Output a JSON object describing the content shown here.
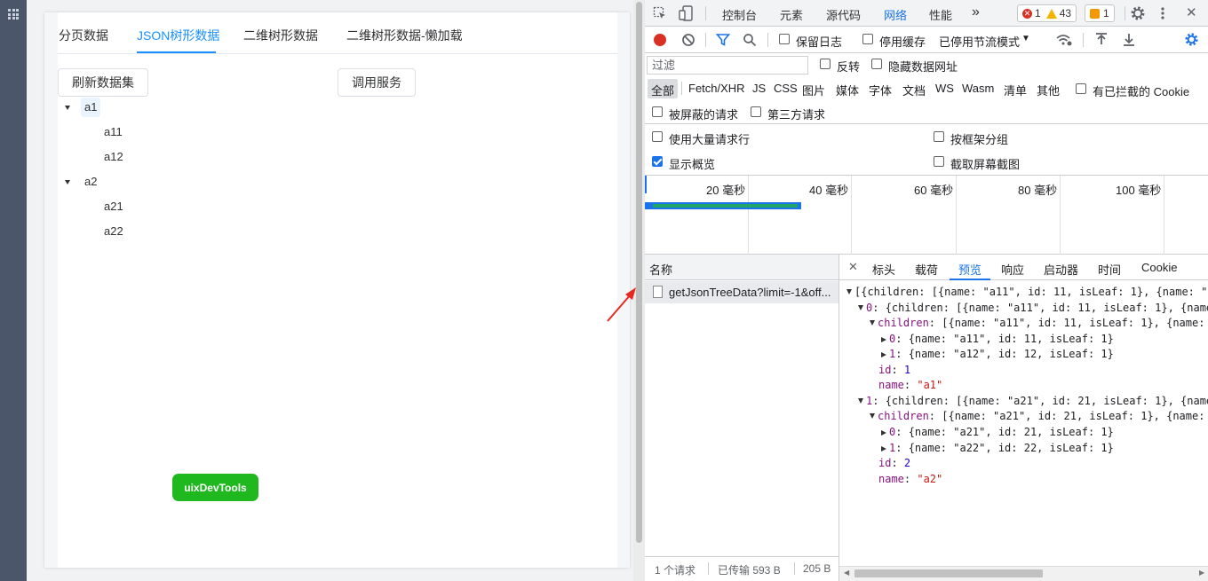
{
  "app": {
    "tabs": [
      {
        "label": "分页数据"
      },
      {
        "label": "JSON树形数据"
      },
      {
        "label": "二维树形数据"
      },
      {
        "label": "二维树形数据-懒加载"
      }
    ],
    "active_tab": 1,
    "refresh_button": "刷新数据集",
    "call_service_button": "调用服务",
    "tree": [
      {
        "label": "a1",
        "children": [
          "a11",
          "a12"
        ]
      },
      {
        "label": "a2",
        "children": [
          "a21",
          "a22"
        ]
      }
    ],
    "devtools_button": "uixDevTools"
  },
  "devtools": {
    "tabs": [
      "控制台",
      "元素",
      "源代码",
      "网络",
      "性能"
    ],
    "active_tab": "网络",
    "more": "»",
    "errors": "1",
    "warnings": "43",
    "messages": "1",
    "close": "✕",
    "toolbar": {
      "preserve_log": "保留日志",
      "disable_cache": "停用缓存",
      "throttle": "已停用节流模式",
      "throttle_arrow": "▼"
    },
    "filter": {
      "placeholder": "过滤",
      "invert": "反转",
      "hide_data_urls": "隐藏数据网址"
    },
    "types": [
      "全部",
      "Fetch/XHR",
      "JS",
      "CSS",
      "图片",
      "媒体",
      "字体",
      "文档",
      "WS",
      "Wasm",
      "清单",
      "其他"
    ],
    "blocked_cookies": "有已拦截的 Cookie",
    "blocked_requests": "被屏蔽的请求",
    "third_party": "第三方请求",
    "settings": {
      "large_rows": "使用大量请求行",
      "group_by_frame": "按框架分组",
      "show_overview": "显示概览",
      "capture_screenshots": "截取屏幕截图"
    },
    "timeline_ticks": [
      "20 毫秒",
      "40 毫秒",
      "60 毫秒",
      "80 毫秒",
      "100 毫秒"
    ],
    "request_list": {
      "header": "名称",
      "rows": [
        "getJsonTreeData?limit=-1&off..."
      ]
    },
    "status_bar": {
      "requests": "1 个请求",
      "transferred": "已传输 593 B",
      "resources": "205 B"
    },
    "detail_tabs": [
      "标头",
      "载荷",
      "预览",
      "响应",
      "启动器",
      "时间",
      "Cookie"
    ],
    "detail_active": "预览",
    "preview_lines": [
      {
        "indent": 0,
        "toggle": "open",
        "text": "[{children: [{name: \"a11\", id: 11, isLeaf: 1}, {name: \"a1"
      },
      {
        "indent": 1,
        "toggle": "open",
        "key": "0",
        "text": "{children: [{name: \"a11\", id: 11, isLeaf: 1}, {name:"
      },
      {
        "indent": 2,
        "toggle": "open",
        "key": "children",
        "text": "[{name: \"a11\", id: 11, isLeaf: 1}, {name: \""
      },
      {
        "indent": 3,
        "toggle": "closed",
        "key": "0",
        "text": "{name: \"a11\", id: 11, isLeaf: 1}"
      },
      {
        "indent": 3,
        "toggle": "closed",
        "key": "1",
        "text": "{name: \"a12\", id: 12, isLeaf: 1}"
      },
      {
        "indent": 2,
        "toggle": "none",
        "key": "id",
        "value": "1",
        "vtype": "n"
      },
      {
        "indent": 2,
        "toggle": "none",
        "key": "name",
        "value": "\"a1\"",
        "vtype": "s"
      },
      {
        "indent": 1,
        "toggle": "open",
        "key": "1",
        "text": "{children: [{name: \"a21\", id: 21, isLeaf: 1}, {name:"
      },
      {
        "indent": 2,
        "toggle": "open",
        "key": "children",
        "text": "[{name: \"a21\", id: 21, isLeaf: 1}, {name: \""
      },
      {
        "indent": 3,
        "toggle": "closed",
        "key": "0",
        "text": "{name: \"a21\", id: 21, isLeaf: 1}"
      },
      {
        "indent": 3,
        "toggle": "closed",
        "key": "1",
        "text": "{name: \"a22\", id: 22, isLeaf: 1}"
      },
      {
        "indent": 2,
        "toggle": "none",
        "key": "id",
        "value": "2",
        "vtype": "n"
      },
      {
        "indent": 2,
        "toggle": "none",
        "key": "name",
        "value": "\"a2\"",
        "vtype": "s"
      }
    ]
  },
  "colors": {
    "accent_blue": "#1890ff",
    "devtools_blue": "#1a73e8",
    "uix_green": "#1fb91f",
    "record_red": "#d93025"
  }
}
